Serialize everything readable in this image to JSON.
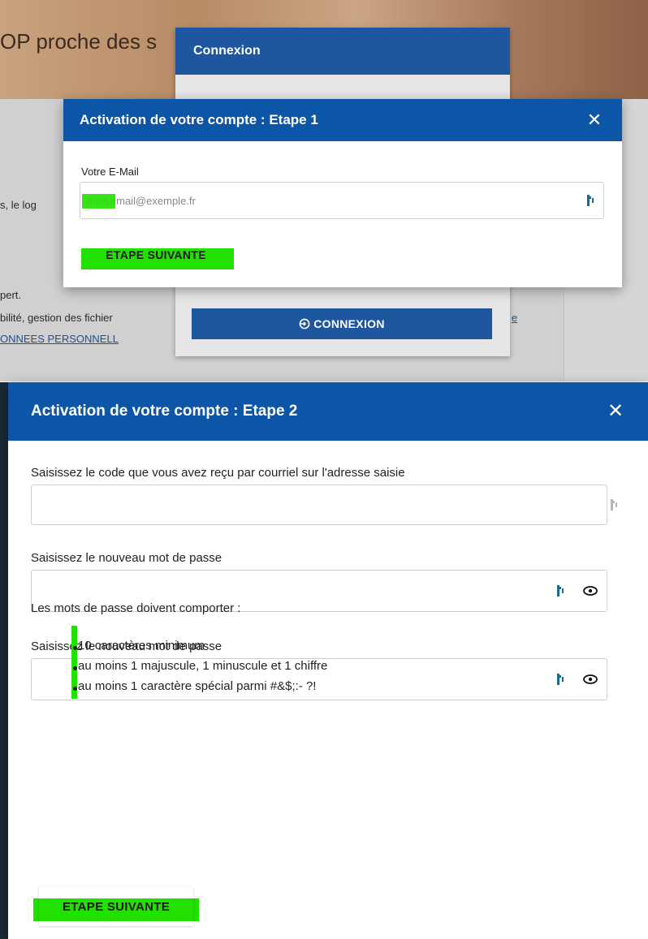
{
  "background": {
    "hero_title": "OP proche des s",
    "fragments": [
      "s, le log",
      "pert.",
      "bilité, gestion des fichier",
      "ONNEES PERSONNELL",
      "e"
    ]
  },
  "connexion_panel": {
    "title": "Connexion",
    "button_label": "CONNEXION"
  },
  "step1": {
    "title": "Activation de votre compte : Etape 1",
    "close_glyph": "✕",
    "email_label": "Votre E-Mail",
    "email_placeholder": "mon.email@exemple.fr",
    "next_label": "ETAPE SUIVANTE"
  },
  "step2": {
    "title": "Activation de votre compte : Etape 2",
    "close_glyph": "✕",
    "code_label": "Saisissez le code que vous avez reçu par courriel sur l'adresse saisie",
    "password_label": "Saisissez le nouveau mot de passe",
    "password_confirm_label": "Saisissez le nouveau mot de passe",
    "rules_title": "Les mots de passe doivent comporter :",
    "rules": [
      "10 caractères minimum",
      "au moins 1 majuscule, 1 minuscule et 1 chiffre",
      "au moins 1 caractère spécial parmi #&$;:- ?!"
    ],
    "next_label": "ETAPE SUIVANTE"
  },
  "icons": {
    "password_manager": "password-manager-icon",
    "show_password": "eye-icon",
    "close": "close-icon",
    "login": "login-icon"
  },
  "colors": {
    "header_blue": "#0d55a6",
    "highlight_green": "#22e000"
  }
}
